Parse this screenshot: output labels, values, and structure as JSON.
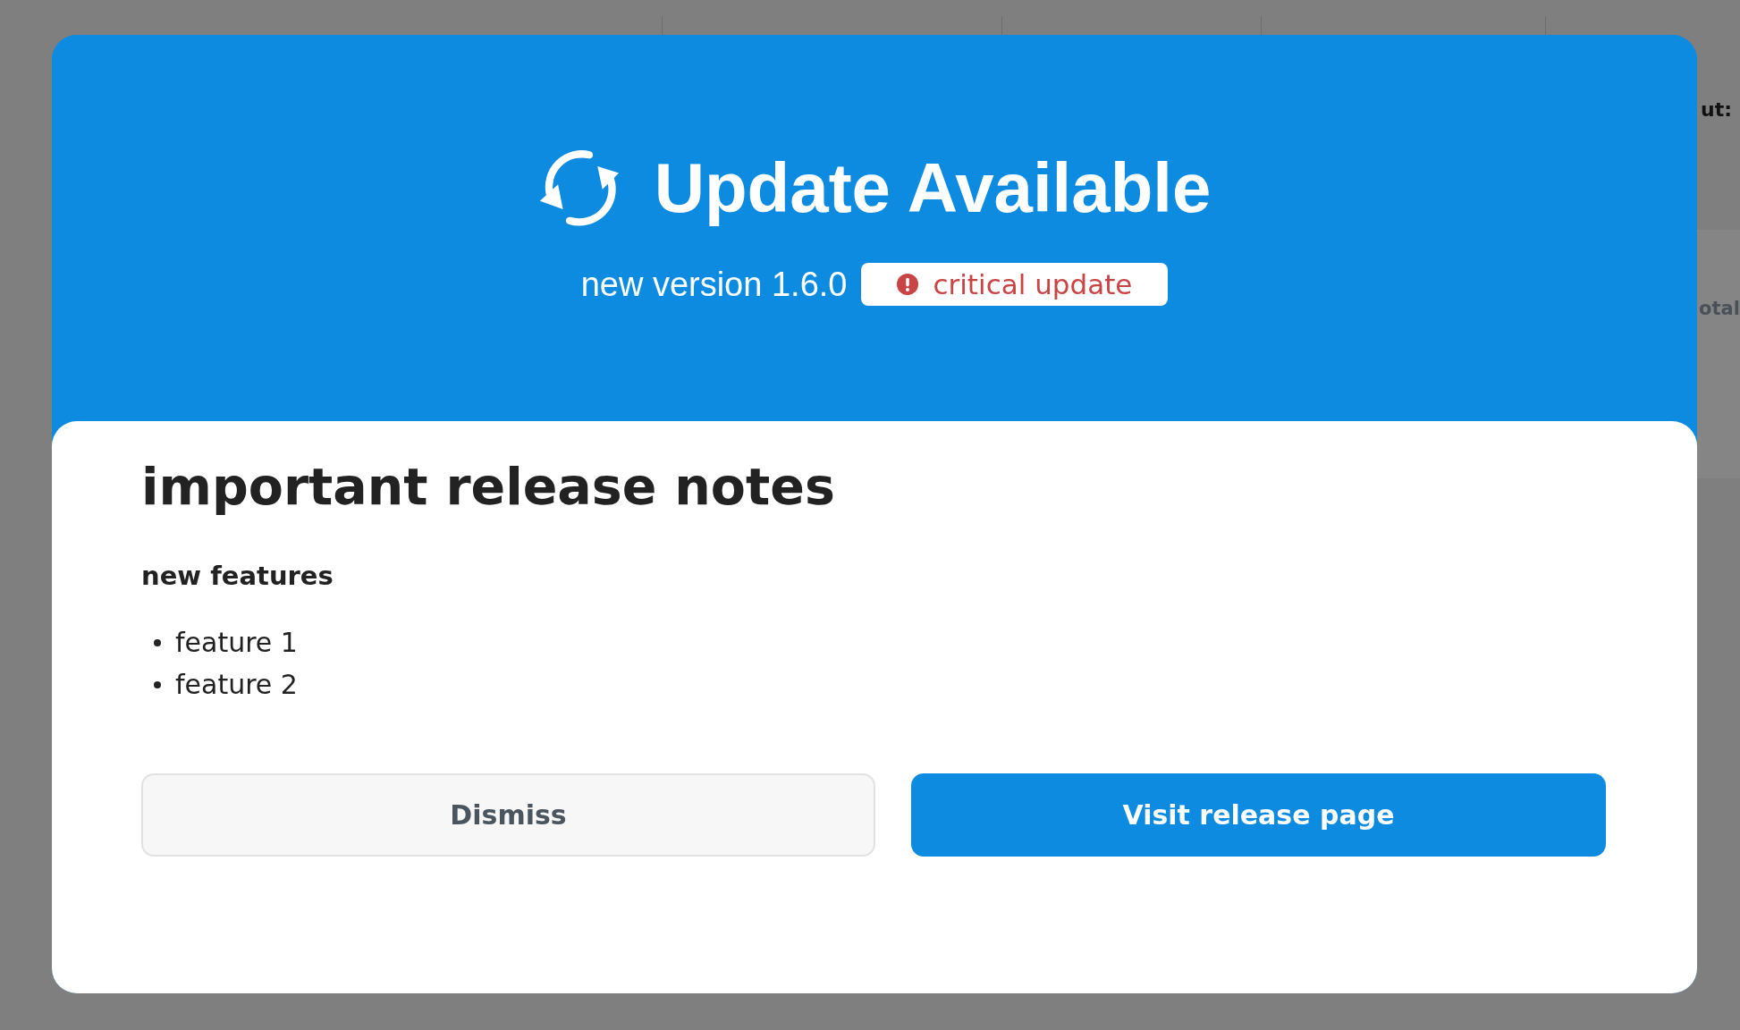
{
  "background": {
    "texts": [
      "ut:",
      "otal"
    ]
  },
  "dialog": {
    "title": "Update Available",
    "version": "new version 1.6.0",
    "badge": {
      "label": "critical update",
      "kind": "critical"
    },
    "notes_title": "important release notes",
    "section_title": "new features",
    "features": [
      "feature 1",
      "feature 2"
    ],
    "buttons": [
      {
        "label": "Dismiss",
        "kind": "secondary"
      },
      {
        "label": "Visit release page",
        "kind": "primary"
      }
    ]
  }
}
